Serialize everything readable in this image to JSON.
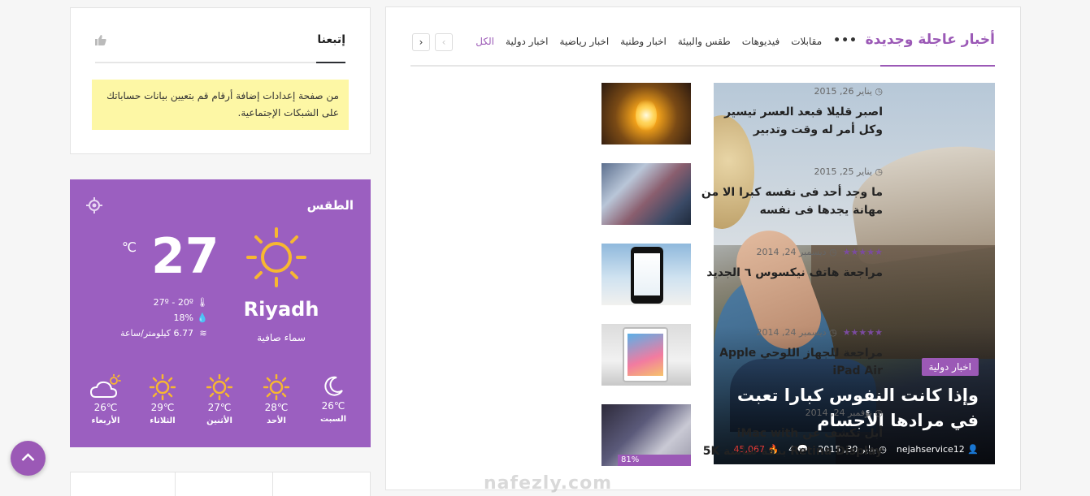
{
  "news": {
    "block_title": "أخبار عاجلة وجديدة",
    "tabs": [
      "الكل",
      "اخبار دولية",
      "اخبار رياضية",
      "اخبار وطنية",
      "طقس والبيئة",
      "فيديوهات",
      "مقابلات"
    ],
    "active_tab": "الكل",
    "more_label": "•••",
    "prev_label": "‹",
    "next_label": "›",
    "featured": {
      "category": "اخبار دولية",
      "title": "وإذا كانت النفوس كبارا تعبت في مرادها الأجسام",
      "author": "nejahservice12",
      "date": "يناير 30, 2015",
      "comments": "4",
      "views": "45,067"
    },
    "posts": [
      {
        "date": "يناير 26, 2015",
        "title": "اصبر قليلا فبعد العسر تيسير وكل أمر له وقت وتدبير",
        "stars": ""
      },
      {
        "date": "يناير 25, 2015",
        "title": "ما وجد أحد فى نفسه كبرا الا من مهانة يجدها فى نفسه",
        "stars": ""
      },
      {
        "date": "ديسمبر 24, 2014",
        "title": "مراجعة هاتف نيكسوس ٦ الجديد",
        "stars": "★★★★★"
      },
      {
        "date": "ديسمبر 24, 2014",
        "title": "مراجعة للجهاز اللوحي Apple iPad Air",
        "stars": "★★★★★"
      },
      {
        "date": "نوفمبر 24, 2014",
        "title": "أبل تكشف عن iMac with Retina Display بدقة شاشة 5K",
        "stars": "",
        "percent": "81%"
      }
    ]
  },
  "follow": {
    "title": "إتبعنا",
    "note": "من صفحة إعدادات إضافة أرقام قم بتعيين بيانات حساباتك على الشبكات الإجتماعية."
  },
  "weather": {
    "title": "الطقس",
    "city": "Riyadh",
    "description": "سماء صافية",
    "temp": "27",
    "unit": "℃",
    "range": "27º - 20º",
    "humidity": "18%",
    "wind": "6.77 كيلومتر/ساعة",
    "forecast": [
      {
        "day": "السبت",
        "temp": "26",
        "icon": "moon-icon"
      },
      {
        "day": "الأحد",
        "temp": "28",
        "icon": "sun-icon"
      },
      {
        "day": "الأثنين",
        "temp": "27",
        "icon": "sun-icon"
      },
      {
        "day": "الثلاثاء",
        "temp": "29",
        "icon": "sun-icon"
      },
      {
        "day": "الأربعاء",
        "temp": "26",
        "icon": "cloud-sun-icon"
      }
    ],
    "deg_unit": "℃"
  },
  "watermark": "nafezly.com",
  "colors": {
    "accent": "#9b59b6",
    "weather_bg": "#9b5fc0",
    "note_bg": "#fdf7a5",
    "views": "#e53935"
  }
}
